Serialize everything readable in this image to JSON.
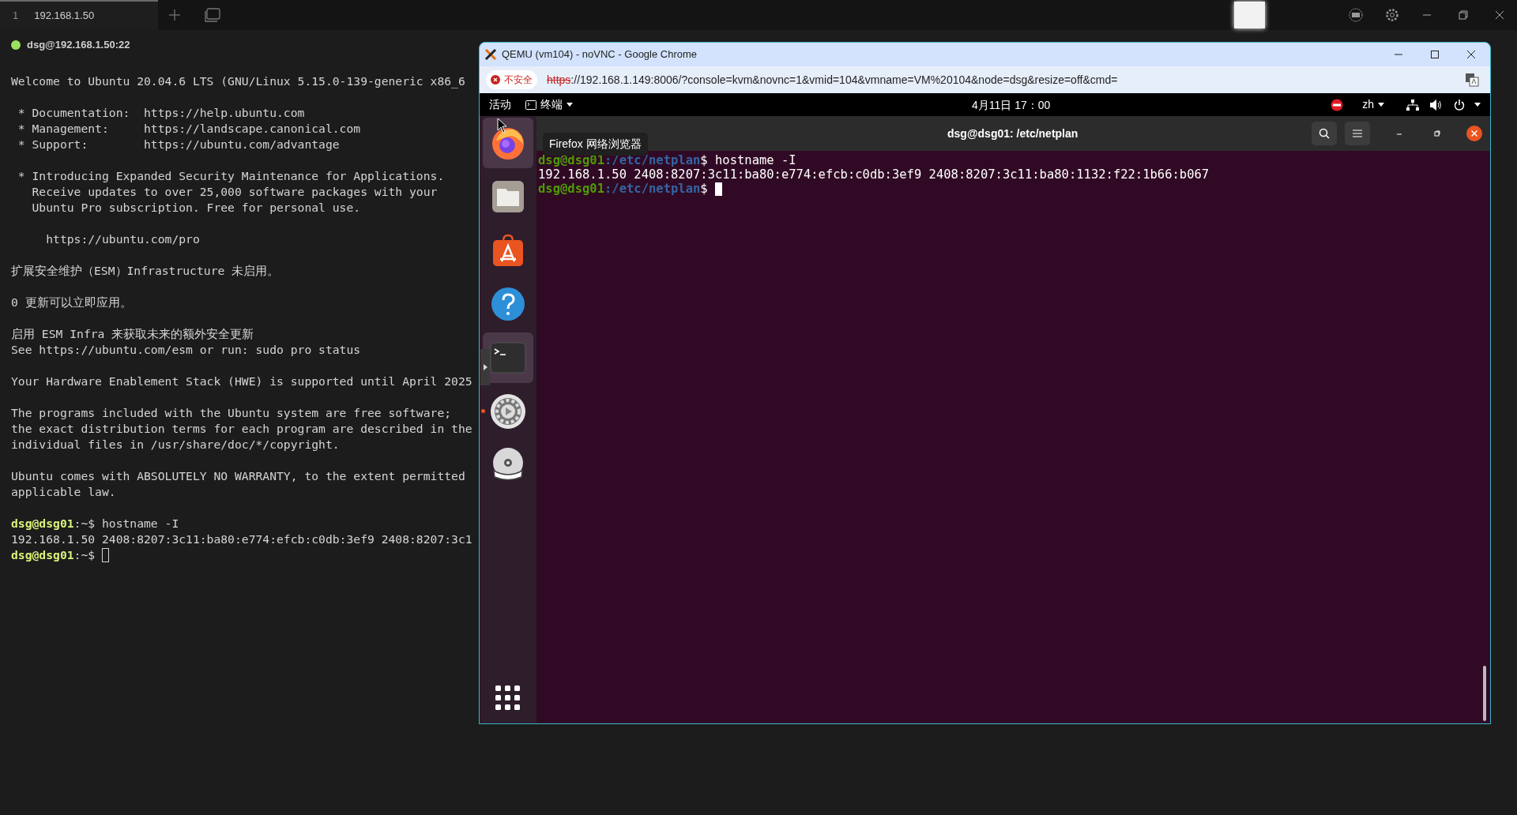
{
  "tabs": [
    {
      "number": "1",
      "label": "192.168.1.50",
      "selected": true
    }
  ],
  "session": {
    "title": "dsg@192.168.1.50:22",
    "connected": true
  },
  "terminal": {
    "lines": [
      {
        "kind": "text",
        "text": "Welcome to Ubuntu 20.04.6 LTS (GNU/Linux 5.15.0-139-generic x86_6"
      },
      {
        "kind": "blank"
      },
      {
        "kind": "text",
        "text": " * Documentation:  https://help.ubuntu.com"
      },
      {
        "kind": "text",
        "text": " * Management:     https://landscape.canonical.com"
      },
      {
        "kind": "text",
        "text": " * Support:        https://ubuntu.com/advantage"
      },
      {
        "kind": "blank"
      },
      {
        "kind": "text",
        "text": " * Introducing Expanded Security Maintenance for Applications."
      },
      {
        "kind": "text",
        "text": "   Receive updates to over 25,000 software packages with your"
      },
      {
        "kind": "text",
        "text": "   Ubuntu Pro subscription. Free for personal use."
      },
      {
        "kind": "blank"
      },
      {
        "kind": "text",
        "text": "     https://ubuntu.com/pro"
      },
      {
        "kind": "blank"
      },
      {
        "kind": "text",
        "text": "扩展安全维护（ESM）Infrastructure 未启用。"
      },
      {
        "kind": "blank"
      },
      {
        "kind": "text",
        "text": "0 更新可以立即应用。"
      },
      {
        "kind": "blank"
      },
      {
        "kind": "text",
        "text": "启用 ESM Infra 来获取未来的额外安全更新"
      },
      {
        "kind": "text",
        "text": "See https://ubuntu.com/esm or run: sudo pro status"
      },
      {
        "kind": "blank"
      },
      {
        "kind": "text",
        "text": "Your Hardware Enablement Stack (HWE) is supported until April 2025"
      },
      {
        "kind": "blank"
      },
      {
        "kind": "text",
        "text": "The programs included with the Ubuntu system are free software;"
      },
      {
        "kind": "text",
        "text": "the exact distribution terms for each program are described in the"
      },
      {
        "kind": "text",
        "text": "individual files in /usr/share/doc/*/copyright."
      },
      {
        "kind": "blank"
      },
      {
        "kind": "text",
        "text": "Ubuntu comes with ABSOLUTELY NO WARRANTY, to the extent permitted"
      },
      {
        "kind": "text",
        "text": "applicable law."
      },
      {
        "kind": "blank"
      },
      {
        "kind": "prompt",
        "user": "dsg@dsg01",
        "path": ":~$",
        "command": " hostname -I"
      },
      {
        "kind": "text",
        "text": "192.168.1.50 2408:8207:3c11:ba80:e774:efcb:c0db:3ef9 2408:8207:3c1"
      },
      {
        "kind": "prompt",
        "user": "dsg@dsg01",
        "path": ":~$",
        "cursor": true
      }
    ]
  },
  "browser": {
    "title": "QEMU (vm104) - noVNC - Google Chrome",
    "security": "不安全",
    "url_scheme": "https",
    "url_rest": "://192.168.1.149:8006/?console=kvm&novnc=1&vmid=104&vmname=VM%20104&node=dsg&resize=off&cmd=",
    "ubuntu": {
      "activities": "活动",
      "app_menu": "终端",
      "clock": "4月11日 17：00",
      "language": "zh",
      "dock": [
        {
          "kind": "firefox",
          "highlighted": true,
          "running": false
        },
        {
          "kind": "files",
          "highlighted": false,
          "running": false
        },
        {
          "kind": "software",
          "highlighted": false,
          "running": false
        },
        {
          "kind": "help",
          "highlighted": false,
          "running": false
        },
        {
          "kind": "terminal",
          "highlighted": true,
          "running": false
        },
        {
          "kind": "settings",
          "highlighted": false,
          "running": true
        },
        {
          "kind": "dvd",
          "highlighted": false,
          "running": false
        }
      ],
      "tooltip": "Firefox 网络浏览器",
      "terminal_title": "dsg@dsg01: /etc/netplan",
      "lines": [
        {
          "kind": "prompt",
          "user": "dsg@dsg01",
          "path": ":/etc/netplan",
          "command": "$ hostname -I"
        },
        {
          "kind": "text",
          "text": "192.168.1.50 2408:8207:3c11:ba80:e774:efcb:c0db:3ef9 2408:8207:3c11:ba80:1132:f22:1b66:b067"
        },
        {
          "kind": "prompt",
          "user": "dsg@dsg01",
          "path": ":/etc/netplan",
          "command": "$ ",
          "cursor": true
        }
      ]
    }
  }
}
